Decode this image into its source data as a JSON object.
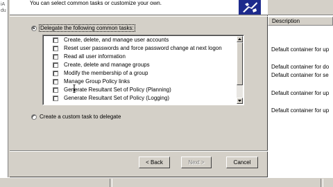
{
  "wizard": {
    "subtitle": "You can select common tasks or customize your own.",
    "option_delegate_label": "Delegate the following common tasks:",
    "option_custom_label": "Create a custom task to delegate",
    "tasks": [
      {
        "label": "Create, delete, and manage user accounts",
        "checked": false
      },
      {
        "label": "Reset user passwords and force password change at next logon",
        "checked": false
      },
      {
        "label": "Read all user information",
        "checked": false
      },
      {
        "label": "Create, delete and manage groups",
        "checked": false
      },
      {
        "label": "Modify the membership of a group",
        "checked": false
      },
      {
        "label": "Manage Group Policy links",
        "checked": false
      },
      {
        "label": "Generate Resultant Set of Policy (Planning)",
        "checked": false
      },
      {
        "label": "Generate Resultant Set of Policy (Logging)",
        "checked": false
      }
    ],
    "selected_option": "delegate",
    "buttons": {
      "back": "< Back",
      "next": "Next >",
      "cancel": "Cancel"
    },
    "icon": "wizard-banner-icon"
  },
  "background": {
    "column_header": "Description",
    "rows": [
      "Default container for up",
      "Default container for do",
      "Default container for se",
      "Default container for up",
      "Default container for up"
    ],
    "left_strip_text": "iAdu"
  },
  "colors": {
    "dialog_face": "#d4d0c8",
    "window_bg": "#ffffff"
  }
}
